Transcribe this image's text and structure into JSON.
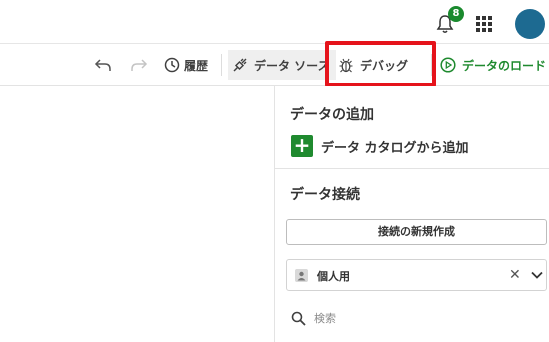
{
  "header": {
    "notification_count": "8",
    "icons": [
      "bell-icon",
      "apps-grid-icon",
      "avatar"
    ],
    "colors": {
      "badge": "#1a8a2e",
      "avatar": "#1d6a91"
    }
  },
  "toolbar": {
    "history_label": "履歴",
    "data_sources_label": "データ ソース",
    "debug_label": "デバッグ",
    "load_data_label": "データのロード",
    "icons": [
      "undo-icon",
      "redo-icon",
      "history-icon",
      "plug-icon",
      "bug-icon",
      "play-icon"
    ],
    "colors": {
      "load_data": "#1f8a2f",
      "highlight": "#e5131b"
    }
  },
  "panel": {
    "add_data_title": "データの追加",
    "add_from_catalog_label": "データ カタログから追加",
    "connections_title": "データ接続",
    "new_connection_label": "接続の新規作成",
    "space_selected": "個人用",
    "search_placeholder": "検索",
    "colors": {
      "add_button": "#1f8a2f"
    }
  }
}
